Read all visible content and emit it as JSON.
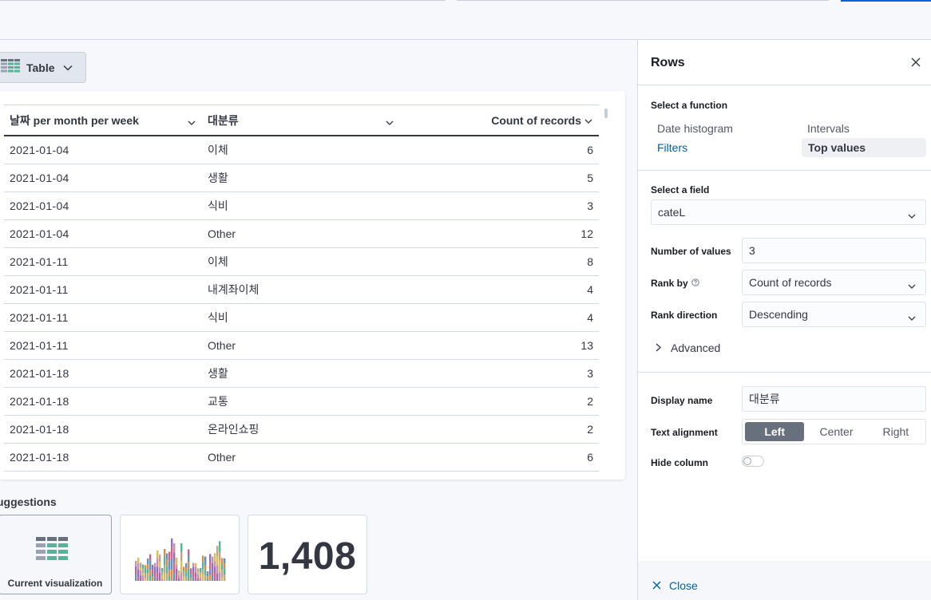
{
  "visualization": {
    "type_label": "Table"
  },
  "table": {
    "columns": [
      "날짜 per month per week",
      "대분류",
      "Count of records"
    ],
    "rows": [
      [
        "2021-01-04",
        "이체",
        "6"
      ],
      [
        "2021-01-04",
        "생활",
        "5"
      ],
      [
        "2021-01-04",
        "식비",
        "3"
      ],
      [
        "2021-01-04",
        "Other",
        "12"
      ],
      [
        "2021-01-11",
        "이체",
        "8"
      ],
      [
        "2021-01-11",
        "내계좌이체",
        "4"
      ],
      [
        "2021-01-11",
        "식비",
        "4"
      ],
      [
        "2021-01-11",
        "Other",
        "13"
      ],
      [
        "2021-01-18",
        "생활",
        "3"
      ],
      [
        "2021-01-18",
        "교통",
        "2"
      ],
      [
        "2021-01-18",
        "온라인쇼핑",
        "2"
      ],
      [
        "2021-01-18",
        "Other",
        "6"
      ]
    ]
  },
  "suggestions": {
    "title": "uggestions",
    "current_label": "Current visualization",
    "metric_value": "1,408"
  },
  "flyout": {
    "title": "Rows",
    "select_function_label": "Select a function",
    "functions": {
      "date_histogram": "Date histogram",
      "intervals": "Intervals",
      "filters": "Filters",
      "top_values": "Top values"
    },
    "select_field_label": "Select a field",
    "field_value": "cateL",
    "number_of_values_label": "Number of values",
    "number_of_values": "3",
    "rank_by_label": "Rank by",
    "rank_by_value": "Count of records",
    "rank_direction_label": "Rank direction",
    "rank_direction_value": "Descending",
    "advanced_label": "Advanced",
    "display_name_label": "Display name",
    "display_name_value": "대분류",
    "text_alignment_label": "Text alignment",
    "alignment_options": [
      "Left",
      "Center",
      "Right"
    ],
    "alignment_selected": "Left",
    "hide_column_label": "Hide column",
    "hide_column": false,
    "close_label": "Close"
  },
  "colors": {
    "accent_link": "#0061a6",
    "selected_button": "#69707d",
    "top_bar_active": "#0b64dd"
  },
  "icons": {
    "vis_type": "table-icon",
    "chevron": "chevron-down-icon",
    "close": "close-icon",
    "help": "question-circle-icon",
    "advanced": "chevron-right-icon"
  }
}
